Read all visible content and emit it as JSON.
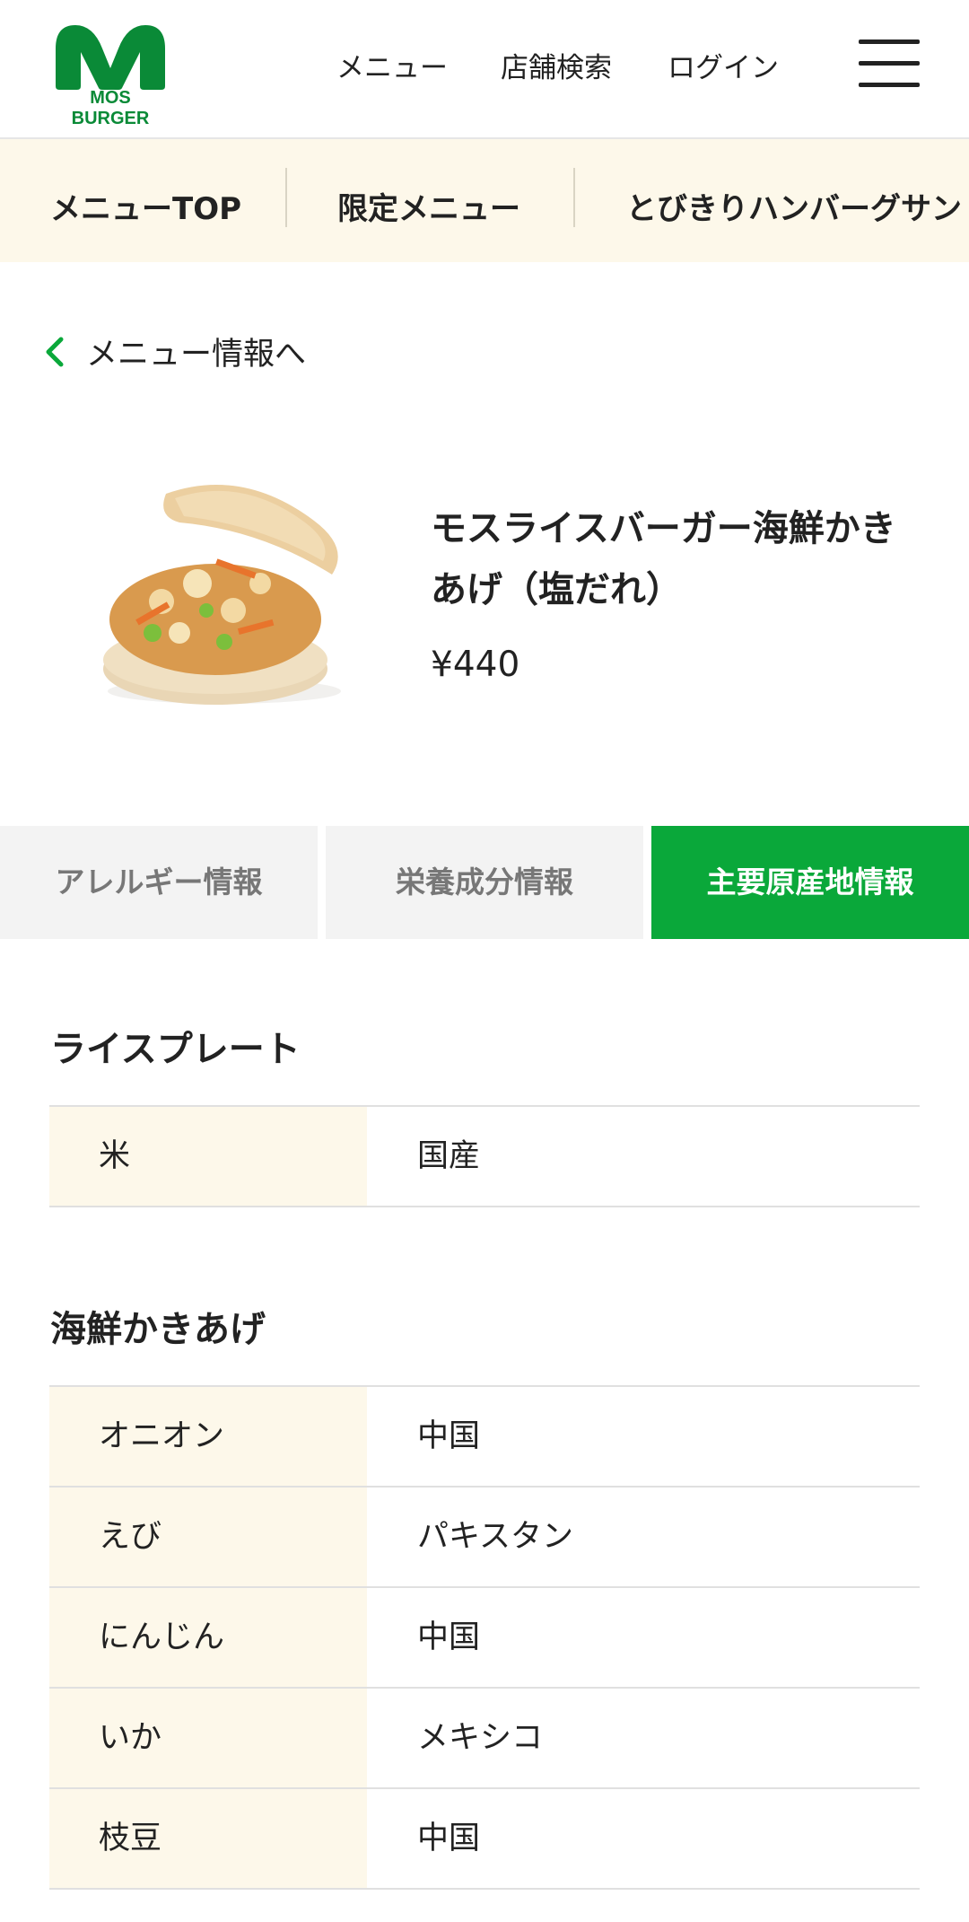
{
  "header": {
    "logo_text": "MOS BURGER",
    "nav": [
      "メニュー",
      "店舗検索",
      "ログイン"
    ],
    "menu_icon": "hamburger-icon"
  },
  "categories": [
    "メニューTOP",
    "限定メニュー",
    "とびきりハンバーグサン"
  ],
  "back_link": "メニュー情報へ",
  "product": {
    "name": "モスライスバーガー海鮮かきあげ（塩だれ）",
    "price": "¥440"
  },
  "tabs": [
    "アレルギー情報",
    "栄養成分情報",
    "主要原産地情報"
  ],
  "active_tab": "主要原産地情報",
  "colors": {
    "brand_green": "#0aa83a",
    "cream": "#fdf8ea"
  },
  "sections": [
    {
      "title": "ライスプレート",
      "rows": [
        {
          "ingredient": "米",
          "origin": "国産"
        }
      ]
    },
    {
      "title": "海鮮かきあげ",
      "rows": [
        {
          "ingredient": "オニオン",
          "origin": "中国"
        },
        {
          "ingredient": "えび",
          "origin": "パキスタン"
        },
        {
          "ingredient": "にんじん",
          "origin": "中国"
        },
        {
          "ingredient": "いか",
          "origin": "メキシコ"
        },
        {
          "ingredient": "枝豆",
          "origin": "中国"
        }
      ]
    }
  ]
}
